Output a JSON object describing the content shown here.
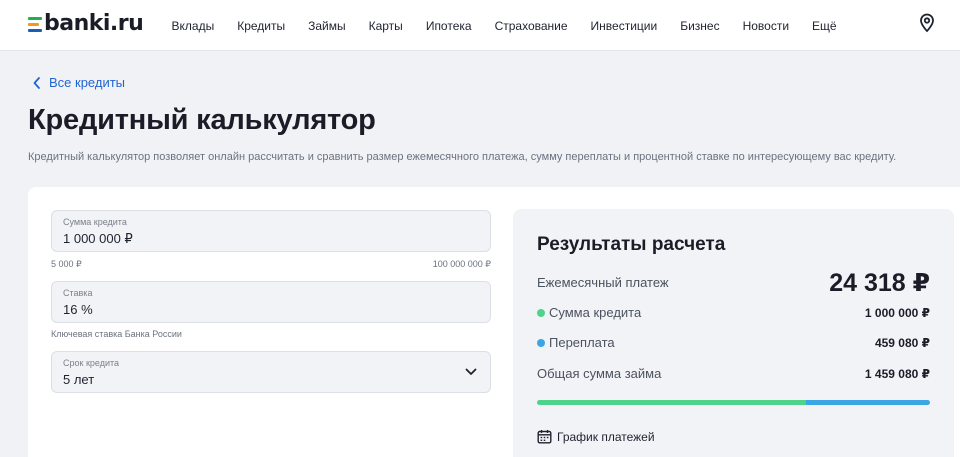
{
  "header": {
    "logo_text": "banki.ru",
    "nav": [
      "Вклады",
      "Кредиты",
      "Займы",
      "Карты",
      "Ипотека",
      "Страхование",
      "Инвестиции",
      "Бизнес",
      "Новости",
      "Ещё"
    ],
    "location_icon": "map-pin-icon"
  },
  "breadcrumb": {
    "back_label": "Все кредиты",
    "icon": "chevron-left-icon"
  },
  "page": {
    "title": "Кредитный калькулятор",
    "description": "Кредитный калькулятор позволяет онлайн рассчитать и сравнить размер ежемесячного платежа, сумму переплаты и процентной ставке по интересующему вас кредиту."
  },
  "form": {
    "amount": {
      "label": "Сумма кредита",
      "value": "1 000 000 ₽",
      "min": "5 000 ₽",
      "max": "100 000 000 ₽"
    },
    "rate": {
      "label": "Ставка",
      "value": "16 %",
      "hint": "Ключевая ставка Банка России"
    },
    "term": {
      "label": "Срок кредита",
      "value": "5 лет",
      "icon": "chevron-down-icon"
    }
  },
  "results": {
    "title": "Результаты расчета",
    "monthly_label": "Ежемесячный платеж",
    "monthly_value": "24 318 ₽",
    "principal_label": "Сумма кредита",
    "principal_value": "1 000 000 ₽",
    "overpay_label": "Переплата",
    "overpay_value": "459 080 ₽",
    "total_label": "Общая сумма займа",
    "total_value": "1 459 080 ₽",
    "principal_share": 0.685,
    "overpay_share": 0.315,
    "schedule_label": "График платежей",
    "schedule_icon": "calendar-icon"
  },
  "colors": {
    "principal": "#4fd38a",
    "overpay": "#3ba6e4",
    "link": "#2265d1"
  }
}
